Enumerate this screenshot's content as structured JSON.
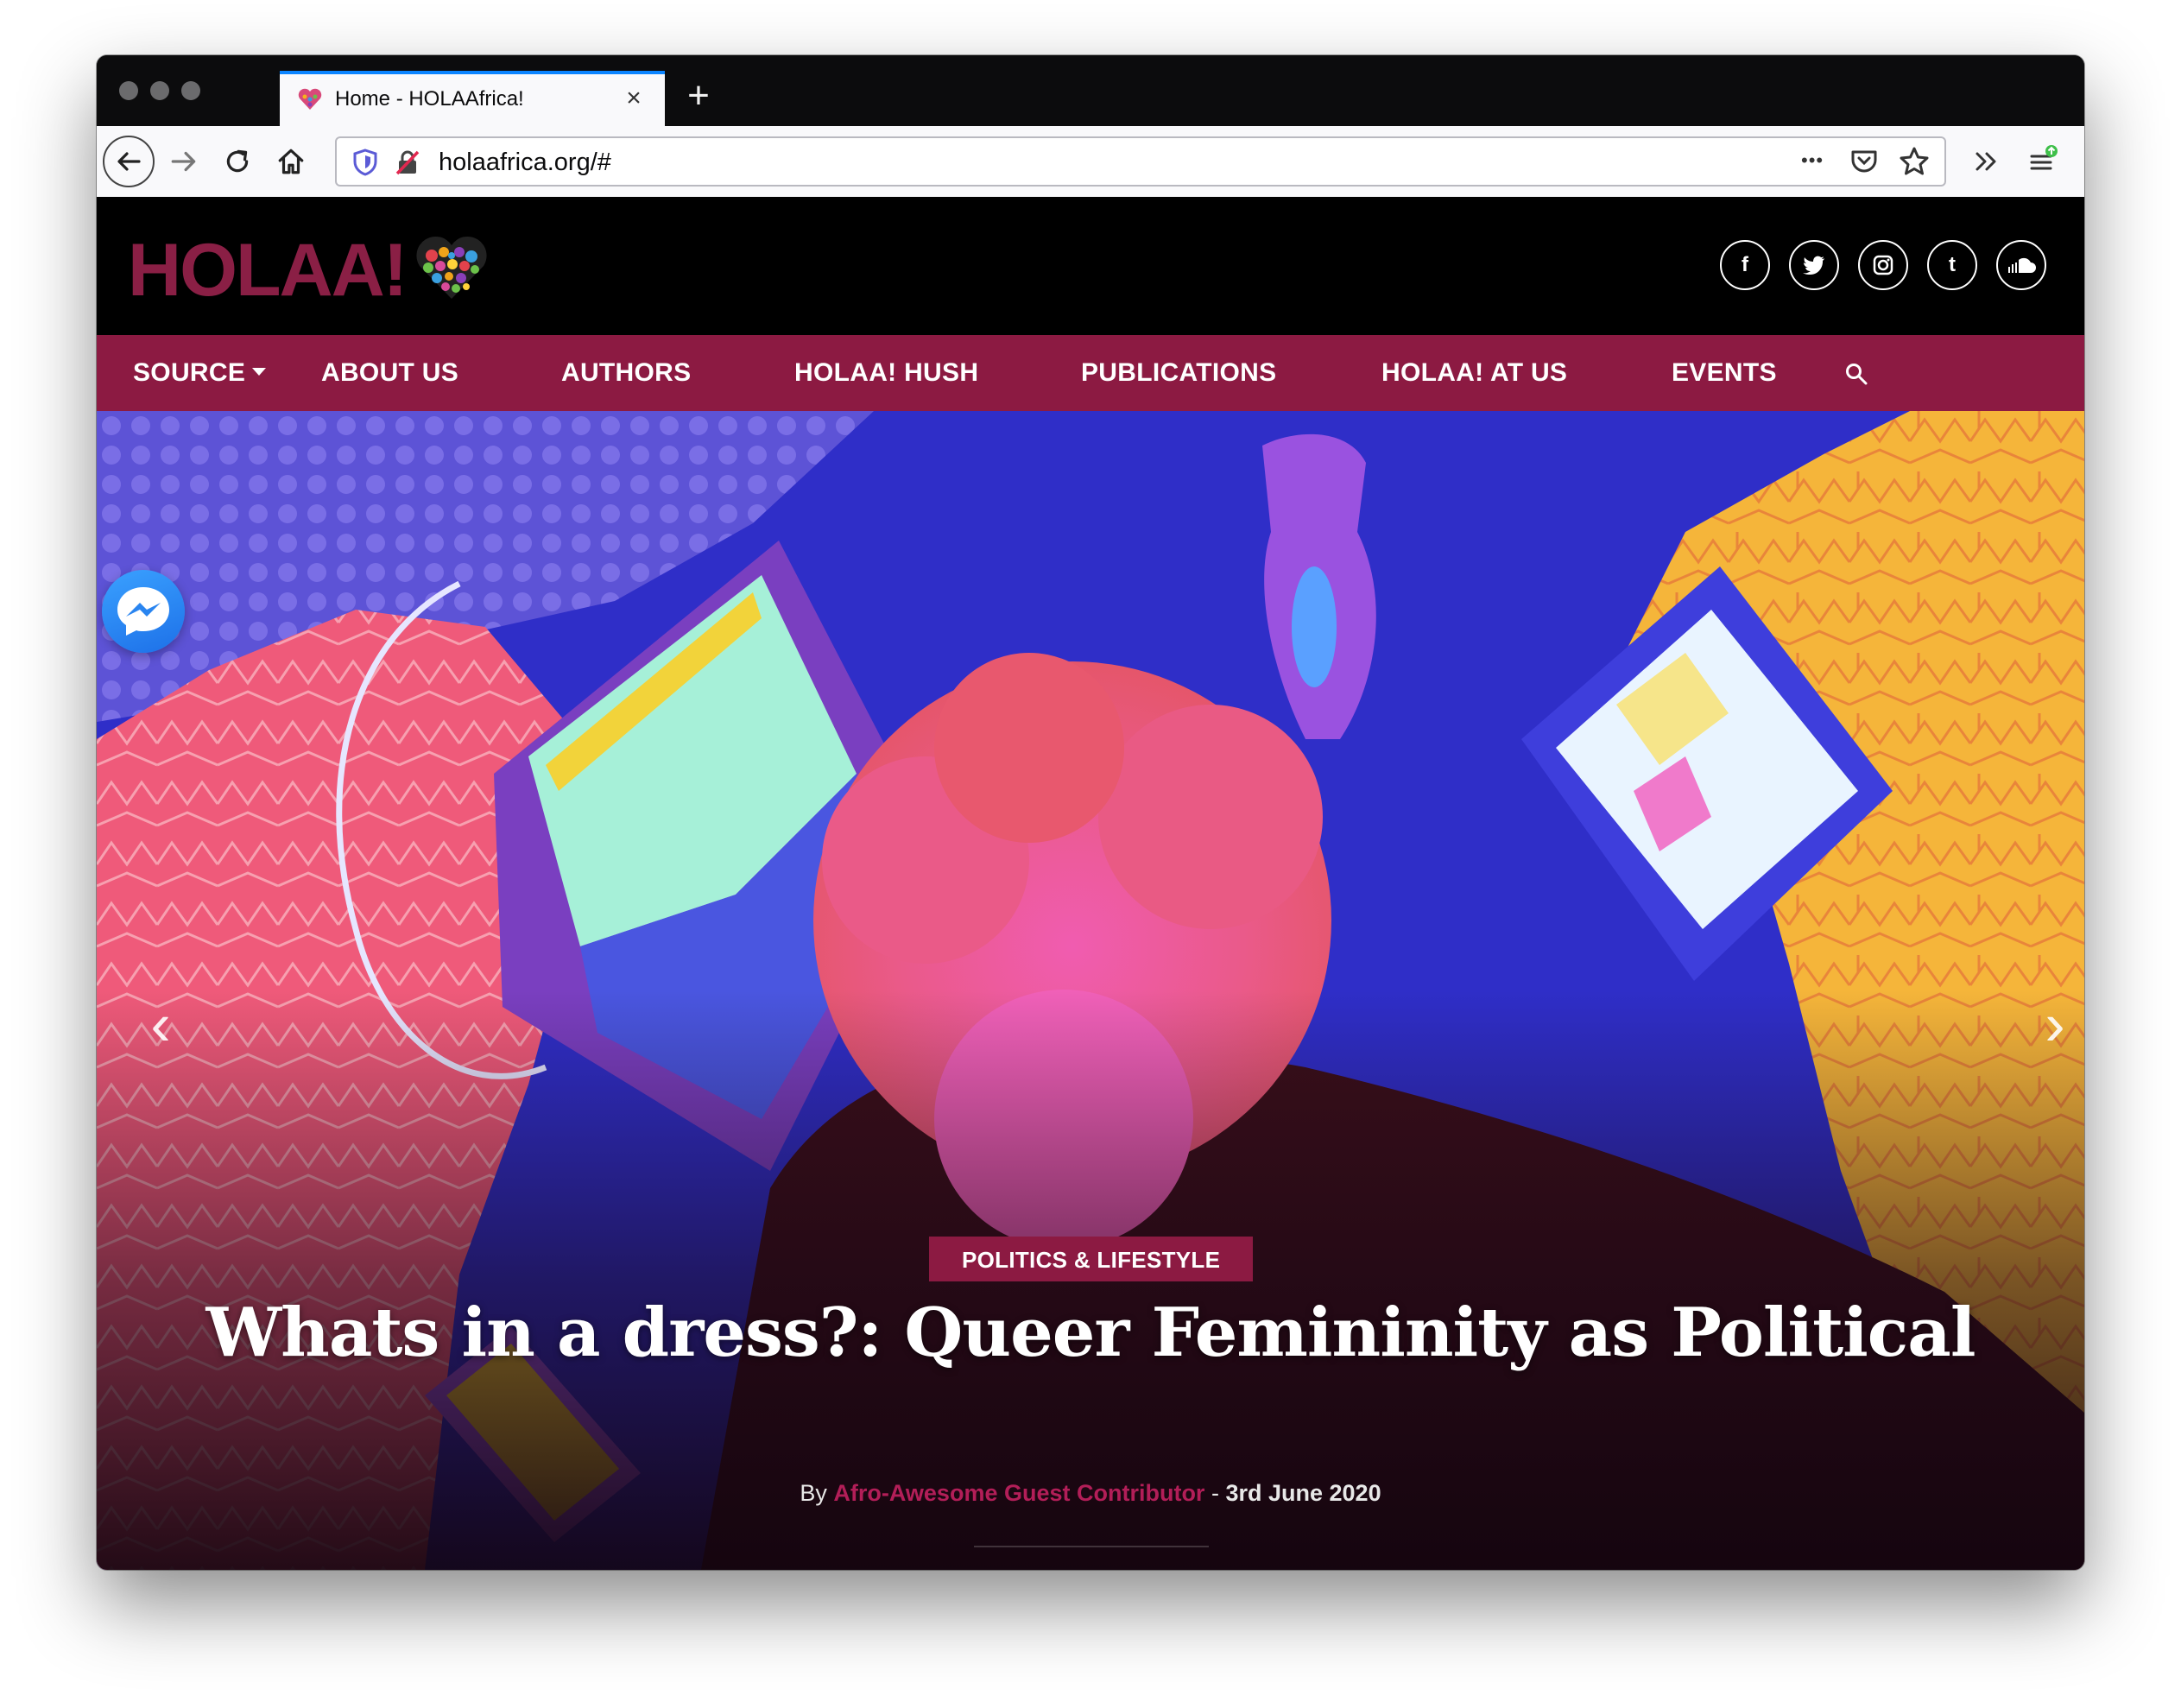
{
  "browser": {
    "tab_title": "Home - HOLAAfrica!",
    "tab_close": "×",
    "new_tab": "+",
    "url": "holaafrica.org/#",
    "menu_dots": "•••"
  },
  "site": {
    "logo_text": "HOLAA!",
    "social": [
      {
        "name": "facebook",
        "glyph": "f"
      },
      {
        "name": "twitter",
        "glyph": "t"
      },
      {
        "name": "instagram",
        "glyph": "◎"
      },
      {
        "name": "tumblr",
        "glyph": "t"
      },
      {
        "name": "soundcloud",
        "glyph": "☁"
      }
    ]
  },
  "nav": {
    "items": [
      {
        "label": "SOURCE"
      },
      {
        "label": "ABOUT US"
      },
      {
        "label": "AUTHORS"
      },
      {
        "label": "HOLAA! HUSH"
      },
      {
        "label": "PUBLICATIONS"
      },
      {
        "label": "HOLAA! AT US"
      },
      {
        "label": "EVENTS"
      }
    ]
  },
  "hero": {
    "category": "POLITICS & LIFESTYLE",
    "headline": "Whats in a dress?: Queer Femininity as Political",
    "by": "By",
    "author": "Afro-Awesome Guest Contributor",
    "separator": "-",
    "date": "3rd June 2020",
    "prev_arrow": "‹",
    "next_arrow": "›"
  },
  "colors": {
    "brand": "#8c1a42",
    "header_bg": "#000000",
    "accent_author": "#b21e58"
  }
}
